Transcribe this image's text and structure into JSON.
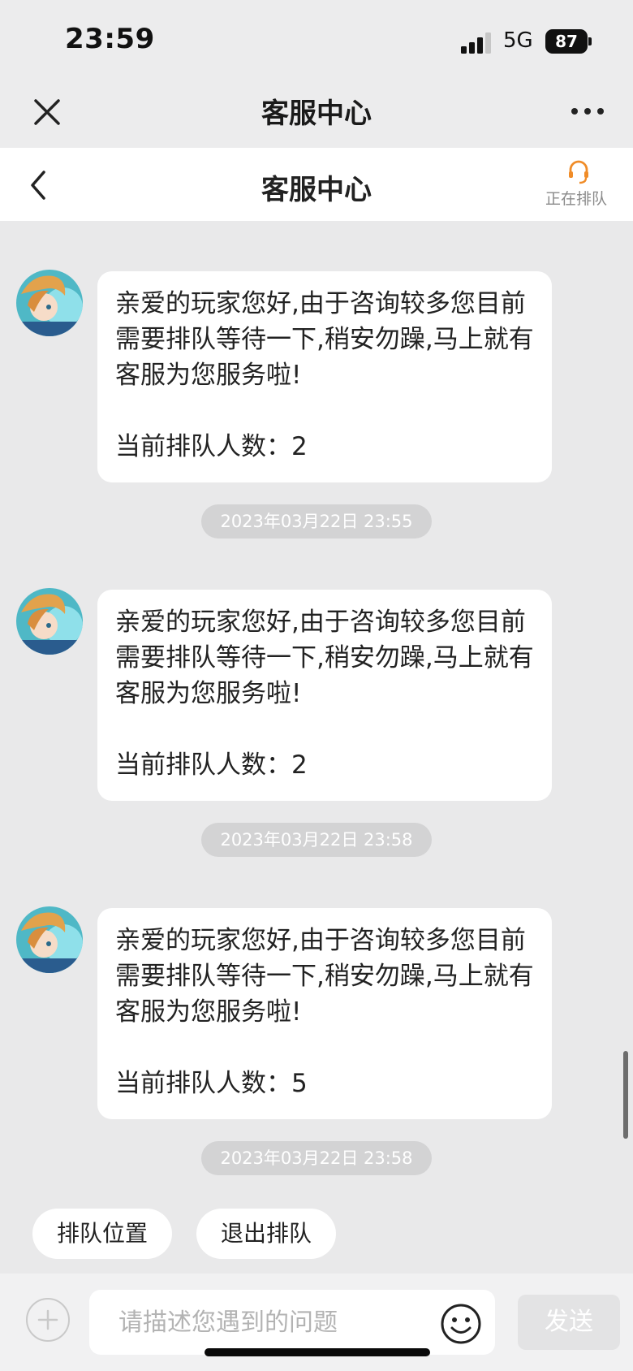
{
  "status_bar": {
    "time": "23:59",
    "network": "5G",
    "battery": "87"
  },
  "outer_nav": {
    "title": "客服中心",
    "close_icon": "close-icon",
    "more_icon": "more-icon"
  },
  "header": {
    "title": "客服中心",
    "queue_status": "正在排队",
    "queue_icon": "headset-icon",
    "accent_color": "#f08c28"
  },
  "messages": [
    {
      "text": "亲爱的玩家您好,由于咨询较多您目前需要排队等待一下,稍安勿躁,马上就有客服为您服务啦!",
      "queue_line": "当前排队人数：2",
      "timestamp": "2023年03月22日 23:55"
    },
    {
      "text": "亲爱的玩家您好,由于咨询较多您目前需要排队等待一下,稍安勿躁,马上就有客服为您服务啦!",
      "queue_line": "当前排队人数：2",
      "timestamp": "2023年03月22日 23:58"
    },
    {
      "text": "亲爱的玩家您好,由于咨询较多您目前需要排队等待一下,稍安勿躁,马上就有客服为您服务啦!",
      "queue_line": "当前排队人数：5",
      "timestamp": "2023年03月22日 23:58"
    }
  ],
  "quick_actions": [
    "排队位置",
    "退出排队"
  ],
  "input": {
    "placeholder": "请描述您遇到的问题",
    "value": "",
    "send_label": "发送"
  }
}
